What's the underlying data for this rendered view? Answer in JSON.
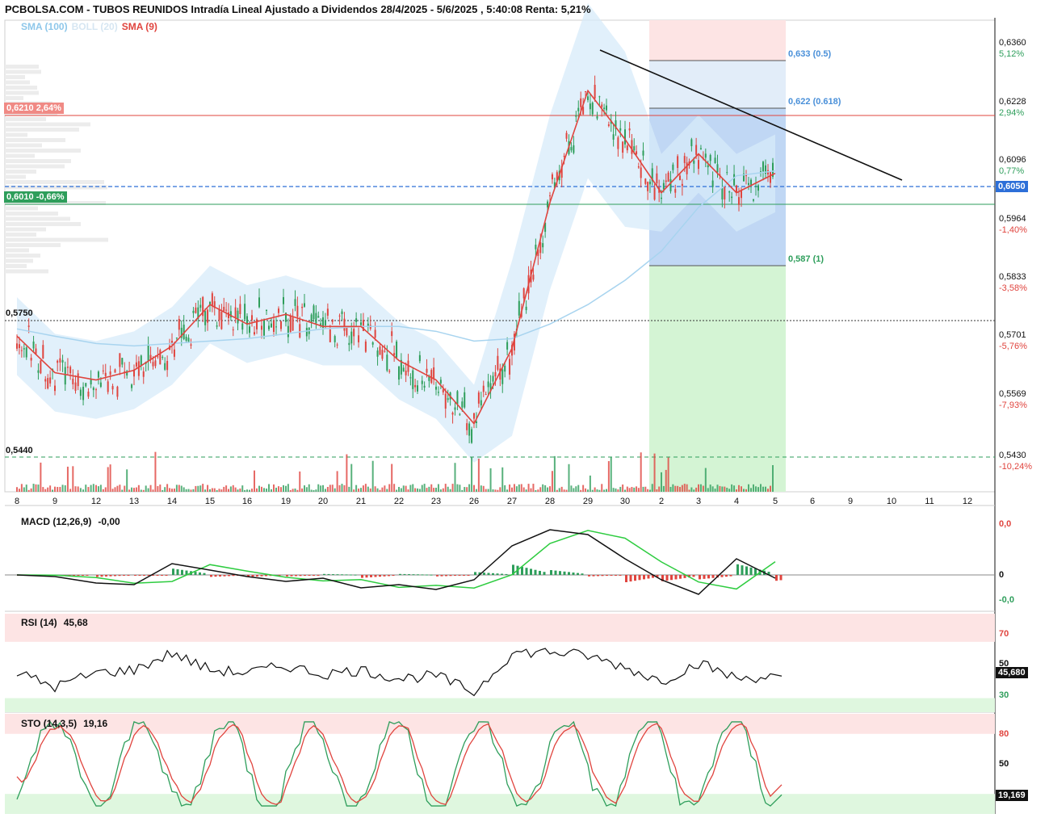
{
  "header": {
    "title": "PCBOLSA.COM - TUBOS REUNIDOS Intradía Lineal Ajustado a Dividendos 28/4/2025 - 5/6/2025 , 5:40:08 Renta: 5,21%"
  },
  "legend": {
    "sma100": "SMA (100)",
    "boll": "BOLL (20)",
    "sma9": "SMA (9)"
  },
  "colors": {
    "up": "#2e9e5b",
    "down": "#e0443e",
    "sma9": "#e0443e",
    "sma100": "#a8d4ef",
    "boll_fill": "#d7ebf9",
    "fib_box": "#b9d3f3",
    "resistance": "#e0443e",
    "support": "#2e9e5b",
    "current_price": "#2d6fd8"
  },
  "price_axis": {
    "labels": [
      "0,6360",
      "0,6228",
      "0,6096",
      "0,5964",
      "0,5833",
      "0,5701",
      "0,5569",
      "0,5430"
    ],
    "percents": [
      "5,12%",
      "2,94%",
      "0,77%",
      "-1,40%",
      "-3,58%",
      "-5,76%",
      "-7,93%",
      "-10,24%"
    ]
  },
  "date_axis": {
    "labels": [
      "8",
      "9",
      "12",
      "13",
      "14",
      "15",
      "16",
      "19",
      "20",
      "21",
      "22",
      "23",
      "26",
      "27",
      "28",
      "29",
      "30",
      "2",
      "3",
      "4",
      "5",
      "6",
      "9",
      "10",
      "11",
      "12"
    ]
  },
  "levels": {
    "resistance_label": "0,6210  2,64%",
    "support_label": "0,6010  -0,66%",
    "dotted_label": "0,5750",
    "bottom_label": "0,5440",
    "current_price": "0,6050"
  },
  "fib": {
    "level_05": "0,633 (0.5)",
    "level_0618": "0,622 (0.618)",
    "level_1": "0,587 (1)"
  },
  "macd": {
    "title": "MACD (12,26,9)",
    "value": "-0,00",
    "axis": [
      "0,0",
      "0",
      "-0,0"
    ]
  },
  "rsi": {
    "title": "RSI (14)",
    "value": "45,68",
    "axis": [
      "70",
      "50",
      "30"
    ],
    "current_box": "45,680"
  },
  "sto": {
    "title": "STO (14,3,5)",
    "value": "19,16",
    "axis": [
      "80",
      "50"
    ],
    "current_box": "19,169"
  },
  "chart_data": {
    "type": "line",
    "title": "TUBOS REUNIDOS Intradía Lineal Ajustado a Dividendos 28/4/2025 - 5/6/2025",
    "series": [
      {
        "name": "SMA (9)",
        "x": [
          "8",
          "9",
          "12",
          "13",
          "14",
          "15",
          "16",
          "19",
          "20",
          "21",
          "22",
          "23",
          "26",
          "27",
          "28",
          "29",
          "30",
          "2",
          "3",
          "4",
          "5"
        ],
        "values": [
          0.5735,
          0.566,
          0.5645,
          0.5665,
          0.5715,
          0.58,
          0.576,
          0.578,
          0.5755,
          0.5755,
          0.5685,
          0.5645,
          0.5555,
          0.571,
          0.601,
          0.624,
          0.614,
          0.603,
          0.611,
          0.603,
          0.607
        ]
      },
      {
        "name": "SMA (100)",
        "x": [
          "8",
          "9",
          "12",
          "13",
          "14",
          "15",
          "16",
          "19",
          "20",
          "21",
          "22",
          "23",
          "26",
          "27",
          "28",
          "29",
          "30",
          "2",
          "3",
          "4",
          "5"
        ],
        "values": [
          0.575,
          0.5735,
          0.572,
          0.5715,
          0.572,
          0.5725,
          0.573,
          0.574,
          0.575,
          0.5755,
          0.5755,
          0.5745,
          0.5725,
          0.573,
          0.576,
          0.58,
          0.585,
          0.591,
          0.6,
          0.6065,
          0.6075
        ]
      }
    ],
    "ylim": [
      0.5415,
      0.6385
    ],
    "current": 0.605,
    "rsi_current": 45.68,
    "sto_current": 19.16,
    "grid": false,
    "legend": "top-left"
  }
}
